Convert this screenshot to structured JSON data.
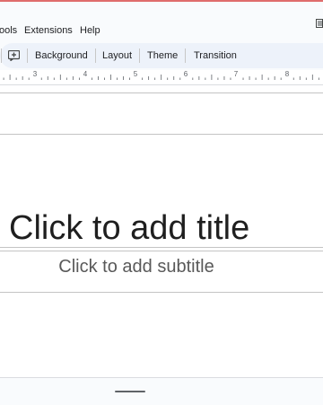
{
  "menu": {
    "tools": "ools",
    "extensions": "Extensions",
    "help": "Help"
  },
  "toolbar": {
    "background": "Background",
    "layout": "Layout",
    "theme": "Theme",
    "transition": "Transition"
  },
  "ruler": {
    "numbers": [
      "3",
      "4",
      "5",
      "6",
      "7",
      "8"
    ]
  },
  "slide": {
    "title_placeholder": "Click to add title",
    "subtitle_placeholder": "Click to add subtitle"
  },
  "icons": {
    "add": "add-comment-icon",
    "menu_right": "comments-icon"
  },
  "colors": {
    "accent": "#e06c6c",
    "toolbar_bg": "#edf2fa"
  }
}
